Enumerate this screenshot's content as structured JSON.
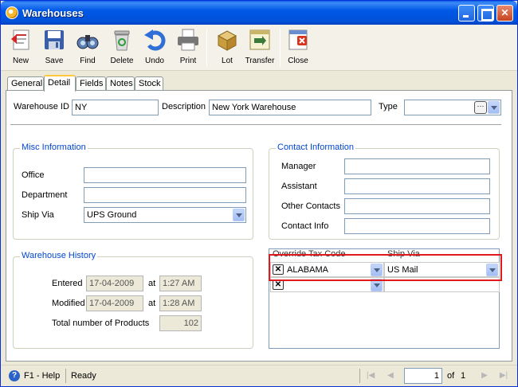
{
  "window": {
    "title": "Warehouses"
  },
  "toolbar": [
    {
      "label": "New",
      "icon": "new-icon"
    },
    {
      "label": "Save",
      "icon": "save-icon"
    },
    {
      "label": "Find",
      "icon": "find-icon"
    },
    {
      "label": "Delete",
      "icon": "delete-icon"
    },
    {
      "label": "Undo",
      "icon": "undo-icon"
    },
    {
      "label": "Print",
      "icon": "print-icon"
    },
    {
      "label": "Lot",
      "icon": "lot-icon"
    },
    {
      "label": "Transfer",
      "icon": "transfer-icon"
    },
    {
      "label": "Close",
      "icon": "close-doc-icon"
    }
  ],
  "tabs": [
    "General",
    "Detail",
    "Fields",
    "Notes",
    "Stock"
  ],
  "active_tab": "Detail",
  "header": {
    "warehouse_id_label": "Warehouse ID",
    "warehouse_id": "NY",
    "description_label": "Description",
    "description": "New York Warehouse",
    "type_label": "Type",
    "type_value": ""
  },
  "misc": {
    "legend": "Misc Information",
    "office_label": "Office",
    "office": "",
    "department_label": "Department",
    "department": "",
    "ship_via_label": "Ship Via",
    "ship_via": "UPS Ground"
  },
  "contact": {
    "legend": "Contact Information",
    "manager_label": "Manager",
    "assistant_label": "Assistant",
    "other_label": "Other Contacts",
    "info_label": "Contact Info",
    "manager": "",
    "assistant": "",
    "other": "",
    "info": ""
  },
  "history": {
    "legend": "Warehouse History",
    "entered_label": "Entered",
    "entered_date": "17-04-2009",
    "entered_time": "1:27 AM",
    "modified_label": "Modified",
    "modified_date": "17-04-2009",
    "modified_time": "1:28 AM",
    "at_label": "at",
    "total_label": "Total number of Products",
    "total": "102"
  },
  "grid": {
    "col_tax": "Override Tax Code",
    "col_ship": "Ship Via",
    "rows": [
      {
        "tax": "ALABAMA",
        "ship": "US Mail"
      },
      {
        "tax": "",
        "ship": ""
      }
    ],
    "delete_glyph": "✕"
  },
  "status": {
    "help": "F1 - Help",
    "state": "Ready",
    "page": "1",
    "of_label": "of",
    "total_pages": "1"
  },
  "colors": {
    "title_bar": "#0058e6",
    "legend": "#0046d5",
    "highlight": "#e0191e"
  }
}
